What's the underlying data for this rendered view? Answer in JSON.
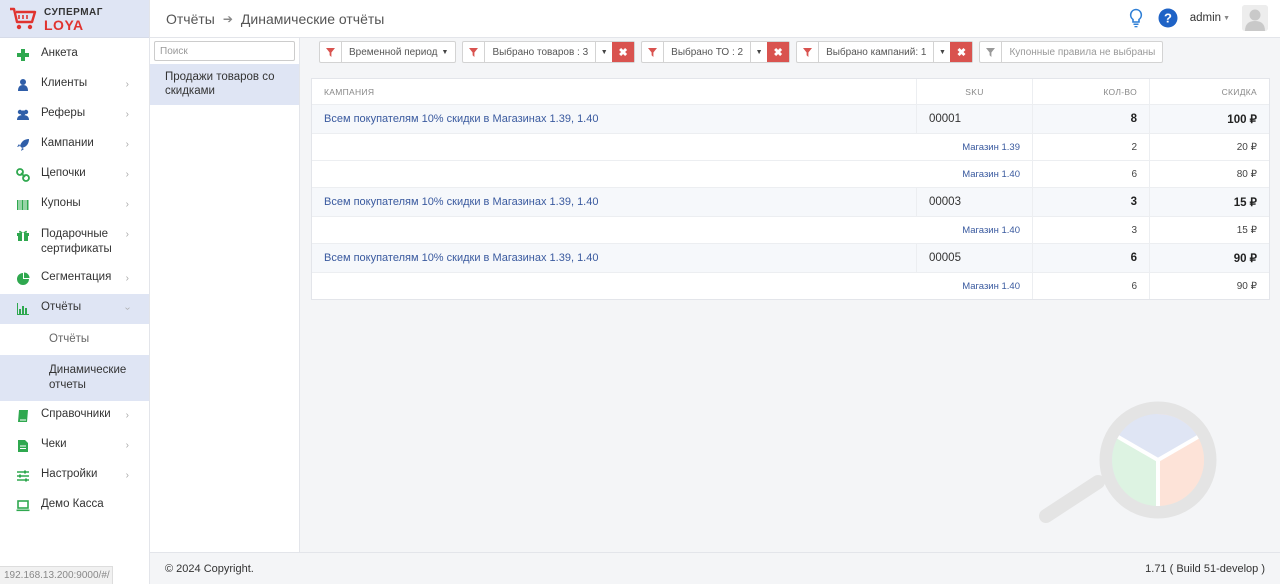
{
  "app": {
    "logo_top": "СУПЕРМАГ",
    "logo_bottom": "LOYA"
  },
  "sidebar": {
    "items": [
      {
        "label": "Анкета",
        "icon": "plus-icon",
        "color": "#2fa84f",
        "chevron": false
      },
      {
        "label": "Клиенты",
        "icon": "user-icon",
        "color": "#2f5ea8",
        "chevron": true
      },
      {
        "label": "Реферы",
        "icon": "users-icon",
        "color": "#2f5ea8",
        "chevron": true
      },
      {
        "label": "Кампании",
        "icon": "rocket-icon",
        "color": "#2f5ea8",
        "chevron": true
      },
      {
        "label": "Цепочки",
        "icon": "chain-icon",
        "color": "#2fa84f",
        "chevron": true
      },
      {
        "label": "Купоны",
        "icon": "barcode-icon",
        "color": "#2fa84f",
        "chevron": true
      },
      {
        "label": "Подарочные сертификаты",
        "icon": "gift-icon",
        "color": "#2fa84f",
        "chevron": true
      },
      {
        "label": "Сегментация",
        "icon": "pie-icon",
        "color": "#2fa84f",
        "chevron": true
      },
      {
        "label": "Отчёты",
        "icon": "bar-chart-icon",
        "color": "#2fa84f",
        "chevron": true
      }
    ],
    "sub_items": [
      "Отчёты",
      "Динамические отчеты"
    ],
    "items_after": [
      {
        "label": "Справочники",
        "icon": "book-icon",
        "color": "#2fa84f",
        "chevron": true
      },
      {
        "label": "Чеки",
        "icon": "receipt-icon",
        "color": "#2fa84f",
        "chevron": true
      },
      {
        "label": "Настройки",
        "icon": "sliders-icon",
        "color": "#2fa84f",
        "chevron": true
      },
      {
        "label": "Демо Касса",
        "icon": "laptop-icon",
        "color": "#2fa84f",
        "chevron": false
      }
    ]
  },
  "status_url": "192.168.13.200:9000/#/",
  "header": {
    "crumb1": "Отчёты",
    "crumb2": "Динамические отчёты",
    "user": "admin"
  },
  "left_panel": {
    "search_placeholder": "Поиск",
    "report": "Продажи товаров со скидками"
  },
  "filters": {
    "period": "Временной период",
    "goods": "Выбрано товаров : 3",
    "to": "Выбрано ТО : 2",
    "campaigns": "Выбрано кампаний: 1",
    "coupons": "Купонные правила не выбраны"
  },
  "table": {
    "headers": {
      "campaign": "КАМПАНИЯ",
      "sku": "SKU",
      "qty": "КОЛ-ВО",
      "discount": "СКИДКА"
    },
    "groups": [
      {
        "campaign": "Всем покупателям 10% скидки в Магазинах 1.39, 1.40",
        "sku": "00001",
        "qty": "8",
        "discount": "100 ₽",
        "rows": [
          {
            "store": "Магазин 1.39",
            "qty": "2",
            "discount": "20 ₽"
          },
          {
            "store": "Магазин 1.40",
            "qty": "6",
            "discount": "80 ₽"
          }
        ]
      },
      {
        "campaign": "Всем покупателям 10% скидки в Магазинах 1.39, 1.40",
        "sku": "00003",
        "qty": "3",
        "discount": "15 ₽",
        "rows": [
          {
            "store": "Магазин 1.40",
            "qty": "3",
            "discount": "15 ₽"
          }
        ]
      },
      {
        "campaign": "Всем покупателям 10% скидки в Магазинах 1.39, 1.40",
        "sku": "00005",
        "qty": "6",
        "discount": "90 ₽",
        "rows": [
          {
            "store": "Магазин 1.40",
            "qty": "6",
            "discount": "90 ₽"
          }
        ]
      }
    ]
  },
  "footer": {
    "copyright": "© 2024 Copyright.",
    "version": "1.71 ( Build 51-develop )"
  },
  "colors": {
    "accent": "#dfe5f4",
    "danger": "#d9534f",
    "link": "#3a5a9f"
  }
}
